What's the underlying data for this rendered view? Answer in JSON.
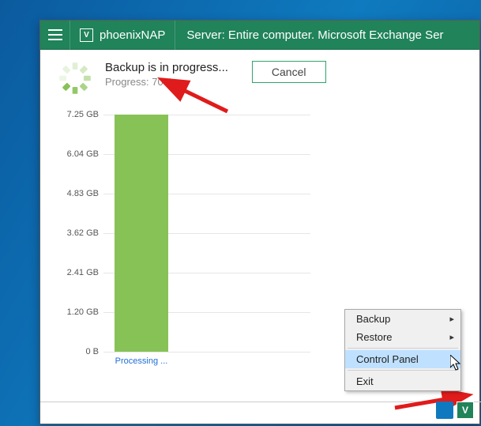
{
  "titlebar": {
    "brand": "phoenixNAP",
    "server_info": "Server: Entire computer. Microsoft Exchange Ser"
  },
  "status": {
    "title": "Backup is in progress...",
    "progress_label": "Progress: 70%",
    "cancel": "Cancel",
    "percent": 70
  },
  "tray_menu": {
    "backup": "Backup",
    "restore": "Restore",
    "control_panel": "Control Panel",
    "exit": "Exit"
  },
  "chart_data": {
    "type": "bar",
    "title": "",
    "xlabel": "",
    "ylabel": "",
    "ylim": [
      0,
      7.25
    ],
    "y_unit": "GB",
    "y_ticks_labels": [
      "7.25 GB",
      "6.04 GB",
      "4.83 GB",
      "3.62 GB",
      "2.41 GB",
      "1.20 GB",
      "0 B"
    ],
    "y_ticks_values": [
      7.25,
      6.04,
      4.83,
      3.62,
      2.41,
      1.2,
      0
    ],
    "categories": [
      "Processing\n..."
    ],
    "values": [
      7.25
    ],
    "series": [
      {
        "name": "Processing",
        "values": [
          7.25
        ],
        "color": "#87c257"
      }
    ]
  },
  "colors": {
    "accent": "#20835a",
    "bar": "#87c257",
    "link": "#1e6fd6",
    "arrow": "#e01b1b"
  }
}
